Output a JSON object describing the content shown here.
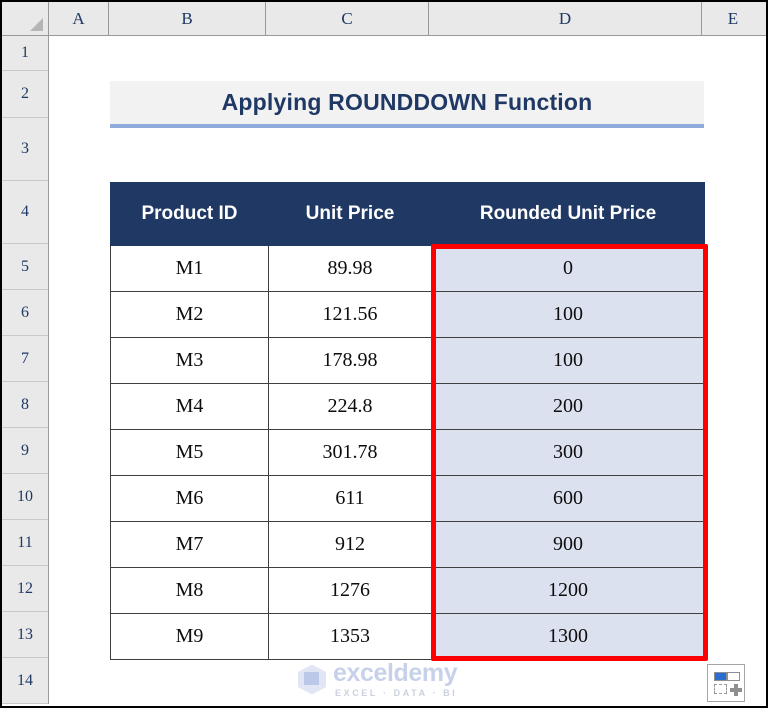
{
  "grid": {
    "column_headers": [
      "A",
      "B",
      "C",
      "D",
      "E"
    ],
    "row_headers": [
      "1",
      "2",
      "3",
      "4",
      "5",
      "6",
      "7",
      "8",
      "9",
      "10",
      "11",
      "12",
      "13",
      "14"
    ]
  },
  "title": {
    "text": "Applying ROUNDDOWN Function"
  },
  "table": {
    "headers": [
      "Product ID",
      "Unit Price",
      "Rounded Unit Price"
    ],
    "rows": [
      {
        "product_id": "M1",
        "unit_price": "89.98",
        "rounded_unit_price": "0"
      },
      {
        "product_id": "M2",
        "unit_price": "121.56",
        "rounded_unit_price": "100"
      },
      {
        "product_id": "M3",
        "unit_price": "178.98",
        "rounded_unit_price": "100"
      },
      {
        "product_id": "M4",
        "unit_price": "224.8",
        "rounded_unit_price": "200"
      },
      {
        "product_id": "M5",
        "unit_price": "301.78",
        "rounded_unit_price": "300"
      },
      {
        "product_id": "M6",
        "unit_price": "611",
        "rounded_unit_price": "600"
      },
      {
        "product_id": "M7",
        "unit_price": "912",
        "rounded_unit_price": "900"
      },
      {
        "product_id": "M8",
        "unit_price": "1276",
        "rounded_unit_price": "1200"
      },
      {
        "product_id": "M9",
        "unit_price": "1353",
        "rounded_unit_price": "1300"
      }
    ]
  },
  "watermark": {
    "name": "exceldemy",
    "tagline": "EXCEL · DATA · BI"
  },
  "colors": {
    "header_navy": "#1f3864",
    "highlight_fill": "#dce1f0",
    "emphasis_red": "#fe0000",
    "title_underline": "#8faadc"
  }
}
